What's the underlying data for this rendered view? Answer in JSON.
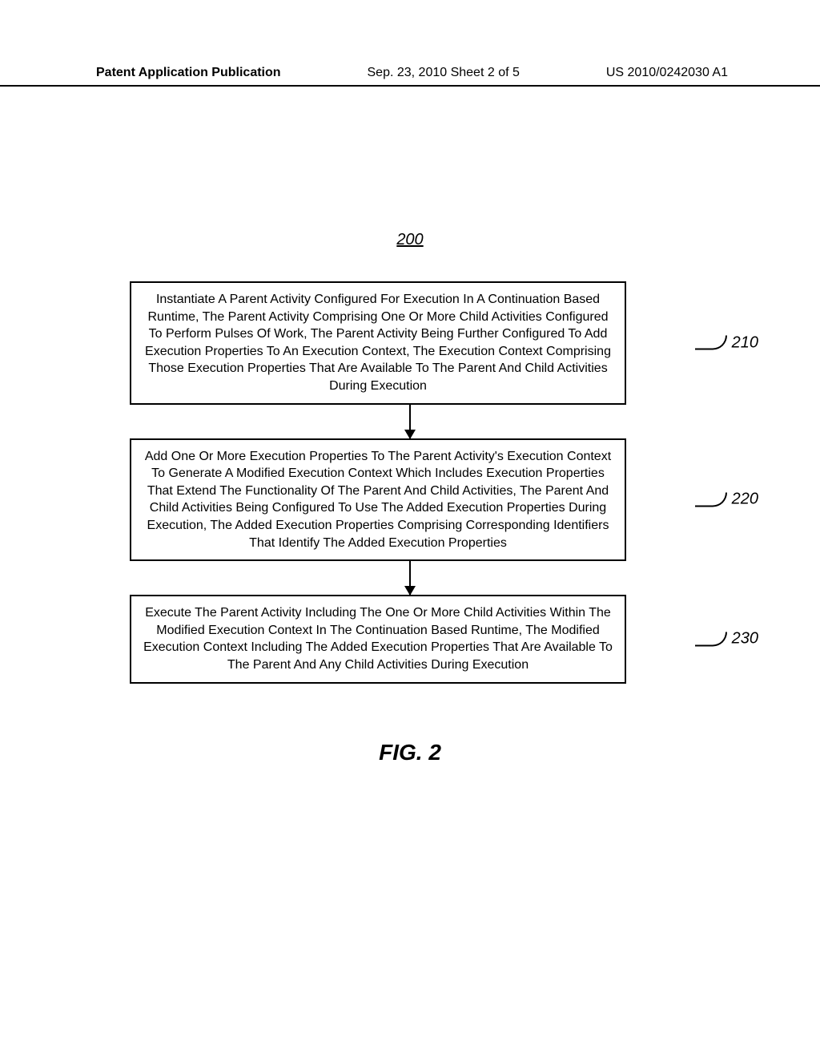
{
  "header": {
    "left": "Patent Application Publication",
    "center": "Sep. 23, 2010  Sheet 2 of 5",
    "right": "US 2010/0242030 A1"
  },
  "figure": {
    "number": "200",
    "label": "FIG. 2"
  },
  "boxes": [
    {
      "text": "Instantiate A Parent Activity Configured For Execution In A Continuation Based Runtime, The Parent Activity Comprising One Or More Child Activities Configured To Perform Pulses Of Work, The Parent Activity Being Further Configured To Add Execution Properties To An Execution Context, The Execution Context Comprising Those Execution Properties That Are Available To The Parent And Child Activities During Execution",
      "ref": "210"
    },
    {
      "text": "Add One Or More Execution Properties To The Parent Activity's Execution Context To Generate A Modified Execution Context Which Includes Execution Properties That Extend The Functionality Of The Parent And Child Activities, The Parent And Child Activities Being Configured To Use The Added Execution Properties During Execution, The Added Execution Properties Comprising Corresponding Identifiers That Identify The Added Execution Properties",
      "ref": "220"
    },
    {
      "text": "Execute The Parent Activity Including The One Or More Child Activities Within The Modified Execution Context In The Continuation Based Runtime, The Modified Execution Context Including The Added Execution Properties That Are Available To The Parent And Any Child Activities During Execution",
      "ref": "230"
    }
  ]
}
